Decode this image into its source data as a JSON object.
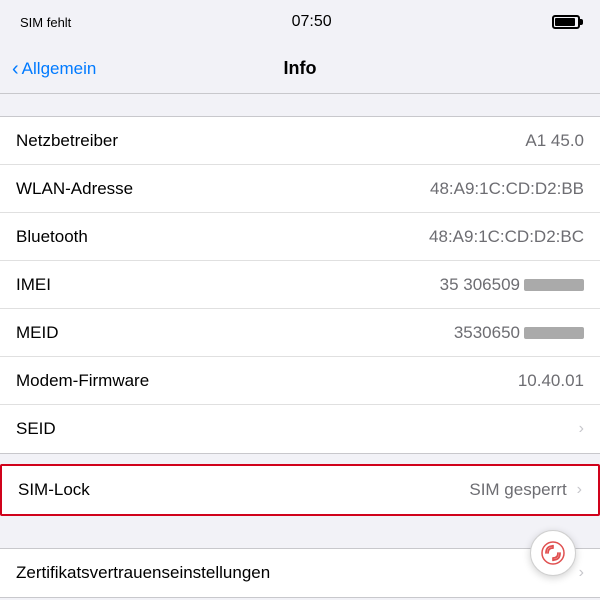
{
  "statusBar": {
    "carrier": "SIM fehlt",
    "time": "07:50"
  },
  "navBar": {
    "backLabel": "Allgemein",
    "title": "Info"
  },
  "rows": [
    {
      "label": "Netzbetreiber",
      "value": "A1 45.0",
      "type": "text"
    },
    {
      "label": "WLAN-Adresse",
      "value": "48:A9:1C:CD:D2:BB",
      "type": "text"
    },
    {
      "label": "Bluetooth",
      "value": "48:A9:1C:CD:D2:BC",
      "type": "text"
    },
    {
      "label": "IMEI",
      "value": "35 306509",
      "type": "redacted"
    },
    {
      "label": "MEID",
      "value": "3530650",
      "type": "redacted"
    },
    {
      "label": "Modem-Firmware",
      "value": "10.40.01",
      "type": "text"
    },
    {
      "label": "SEID",
      "value": "",
      "type": "chevron"
    }
  ],
  "simLock": {
    "label": "SIM-Lock",
    "value": "SIM gesperrt"
  },
  "zertifikats": {
    "label": "Zertifikatsvertrauenseinstellungen"
  },
  "icons": {
    "chevronRight": "›",
    "chevronBack": "‹"
  }
}
